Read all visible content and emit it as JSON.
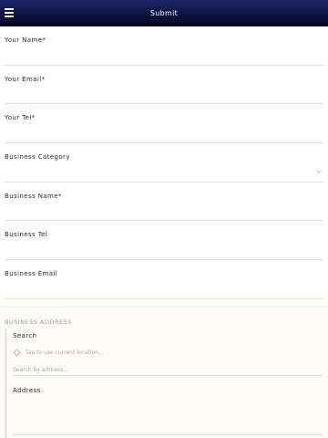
{
  "header": {
    "title": "Submit",
    "menu_icon": "hamburger-icon"
  },
  "fields": [
    {
      "label": "Your Name*",
      "value": ""
    },
    {
      "label": "Your Email*",
      "value": ""
    },
    {
      "label": "Your Tel*",
      "value": ""
    },
    {
      "label": "Business Category",
      "value": ""
    },
    {
      "label": "Business Name*",
      "value": ""
    },
    {
      "label": "Business Tel",
      "value": ""
    },
    {
      "label": "Business Email",
      "value": ""
    }
  ],
  "address": {
    "section_title": "BUSINESS ADDRESS",
    "search_label": "Search",
    "current_location_text": "Tap to use current location...",
    "search_placeholder": "Search by address...",
    "address_label": "Address",
    "address_value": ""
  },
  "colors": {
    "header_top": "#1c2466",
    "header_bottom": "#050821",
    "divider": "#dcdcdc",
    "muted_text": "#a8a8a8"
  }
}
